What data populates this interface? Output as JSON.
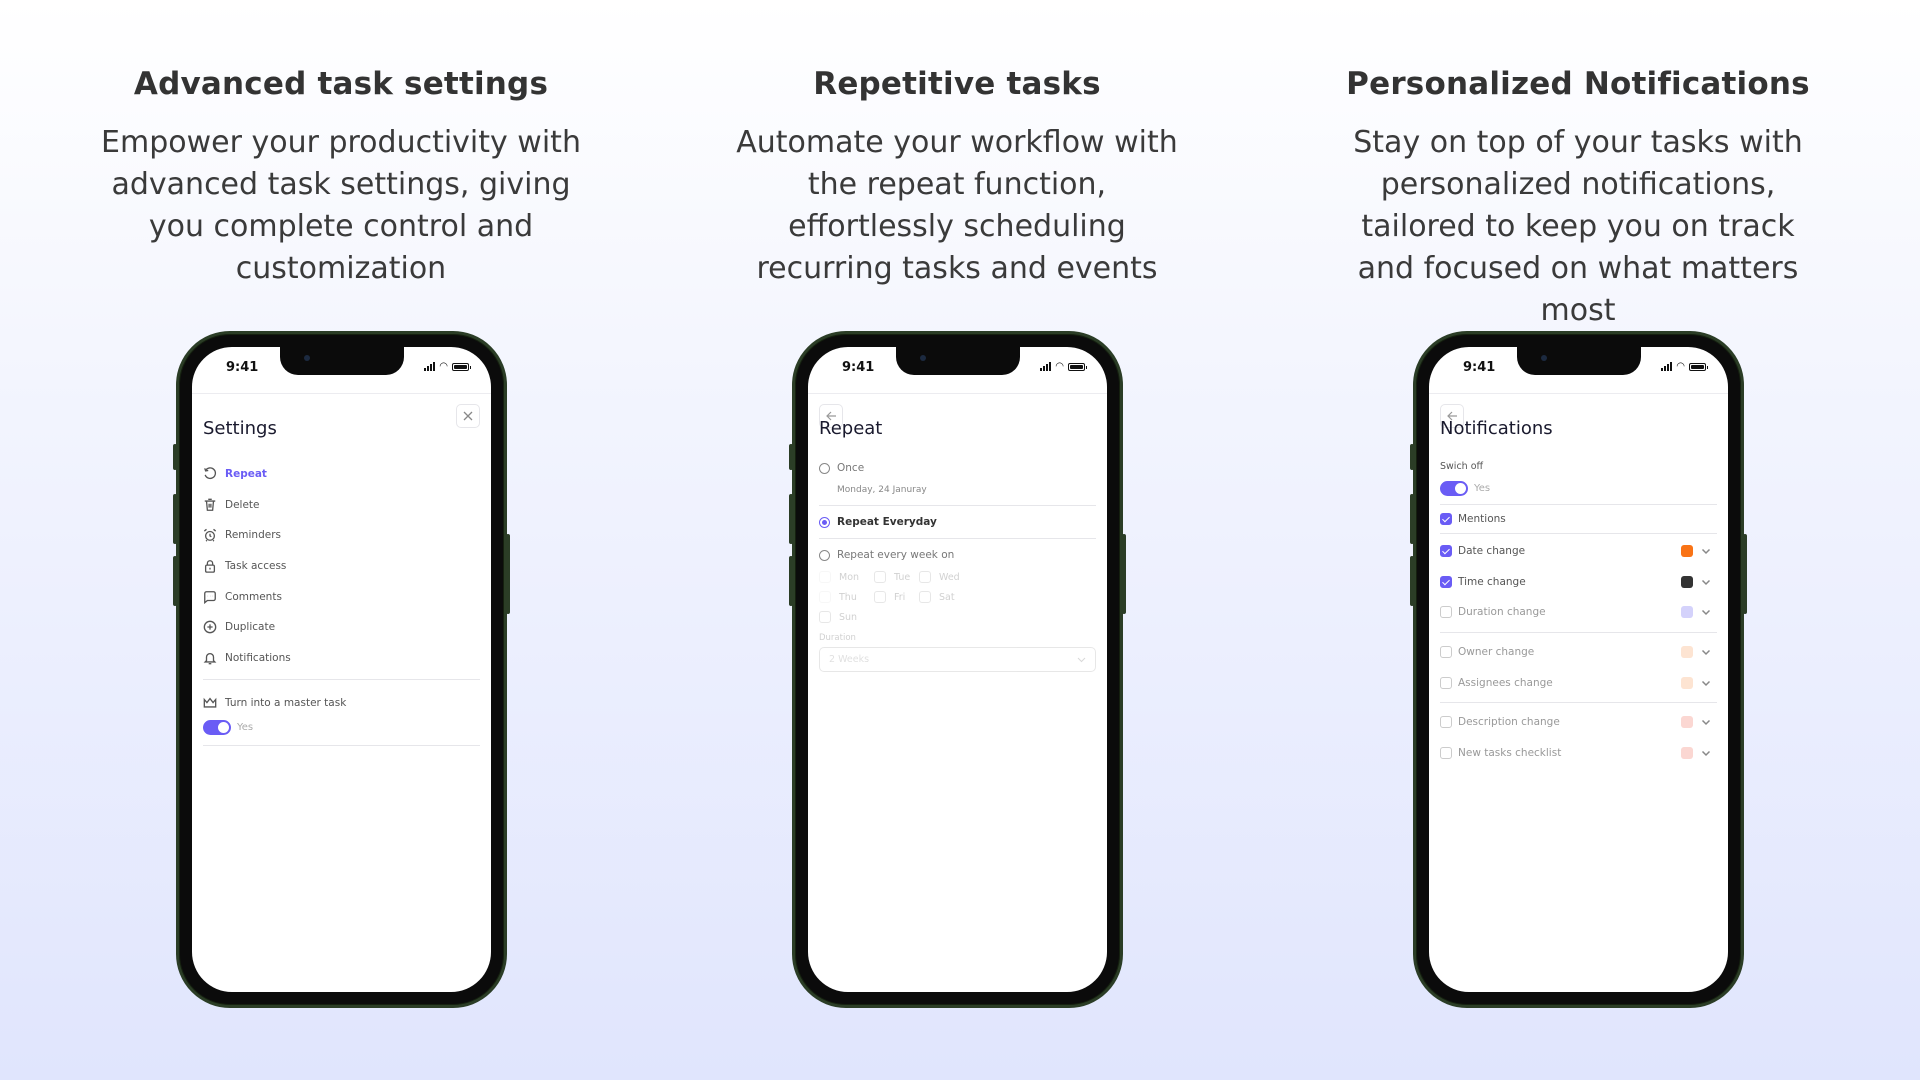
{
  "columns": [
    {
      "heading": "Advanced task settings",
      "description": "Empower your productivity with advanced task settings, giving you complete control and customization"
    },
    {
      "heading": "Repetitive tasks",
      "description": "Automate your workflow with the repeat function, effortlessly scheduling recurring tasks and events"
    },
    {
      "heading": "Personalized Notifications",
      "description": "Stay on top of your tasks with personalized notifications, tailored to keep you on track and focused on what matters most"
    }
  ],
  "status_bar": {
    "time": "9:41"
  },
  "settings_screen": {
    "title": "Settings",
    "close_icon": "close-icon",
    "items": [
      {
        "label": "Repeat",
        "icon": "repeat-icon",
        "active": true
      },
      {
        "label": "Delete",
        "icon": "trash-icon"
      },
      {
        "label": "Reminders",
        "icon": "alarm-icon"
      },
      {
        "label": "Task access",
        "icon": "lock-icon"
      },
      {
        "label": "Comments",
        "icon": "comment-icon"
      },
      {
        "label": "Duplicate",
        "icon": "plus-circle-icon"
      },
      {
        "label": "Notifications",
        "icon": "bell-icon"
      }
    ],
    "master_task": {
      "label": "Turn into a master task",
      "icon": "crown-icon",
      "toggle_on": true,
      "toggle_label": "Yes"
    }
  },
  "repeat_screen": {
    "title": "Repeat",
    "back_icon": "arrow-left-icon",
    "once": {
      "label": "Once",
      "date": "Monday, 24 Januray",
      "selected": false
    },
    "everyday": {
      "label": "Repeat Everyday",
      "selected": true
    },
    "weekly": {
      "label": "Repeat every week on",
      "selected": false,
      "days": [
        "Mon",
        "Tue",
        "Wed",
        "Thu",
        "Fri",
        "Sat",
        "Sun"
      ]
    },
    "duration": {
      "label": "Duration",
      "value": "2 Weeks"
    }
  },
  "notifications_screen": {
    "title": "Notifications",
    "back_icon": "arrow-left-icon",
    "switch_off": {
      "label": "Swich off",
      "toggle_on": true,
      "toggle_label": "Yes"
    },
    "mentions": {
      "label": "Mentions",
      "checked": true
    },
    "groups": [
      [
        {
          "label": "Date change",
          "checked": true,
          "color": "#f97316"
        },
        {
          "label": "Time change",
          "checked": true,
          "color": "#333333"
        },
        {
          "label": "Duration change",
          "checked": false,
          "color": "#d4d2fb"
        }
      ],
      [
        {
          "label": "Owner change",
          "checked": false,
          "color": "#fde4d2"
        },
        {
          "label": "Assignees change",
          "checked": false,
          "color": "#fde4d2"
        }
      ],
      [
        {
          "label": "Description change",
          "checked": false,
          "color": "#fbd7d2"
        },
        {
          "label": "New tasks checklist",
          "checked": false,
          "color": "#fbd7d2"
        }
      ]
    ]
  },
  "colors": {
    "accent": "#6a5cf5",
    "frame": "#2b3d26"
  }
}
